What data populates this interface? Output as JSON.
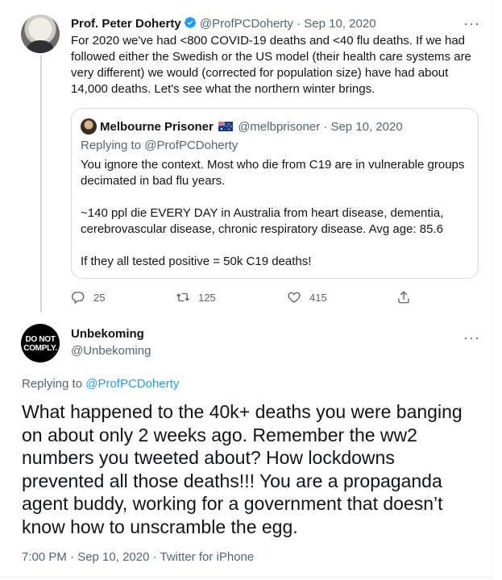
{
  "tweet1": {
    "name": "Prof. Peter Doherty",
    "handle_date": "@ProfPCDoherty · Sep 10, 2020",
    "text": "For 2020 we've had <800 COVID-19 deaths and <40 flu deaths. If we had followed either the Swedish or the US model (their health care systems are very different) we would (corrected for population size) have had about 14,000 deaths. Let's see what the northern winter brings.",
    "quote": {
      "name": "Melbourne Prisoner",
      "handle_date": "@melbprisoner · Sep 10, 2020",
      "replying_to": "Replying to @ProfPCDoherty",
      "text": "You ignore the context. Most who die from C19 are in vulnerable groups decimated in bad flu years.\n\n~140 ppl die EVERY DAY in Australia from heart disease, dementia, cerebrovascular disease, chronic respiratory disease. Avg age: 85.6\n\nIf they all tested positive = 50k C19 deaths!"
    },
    "actions": {
      "replies": "25",
      "retweets": "125",
      "likes": "415"
    }
  },
  "tweet2": {
    "avatar_text": "DO NOT COMPLY.",
    "name": "Unbekoming",
    "handle": "@Unbekoming",
    "replying_label": "Replying to",
    "replying_handle": "@ProfPCDoherty",
    "text": "What happened to the 40k+ deaths you were banging on about only 2 weeks ago. Remember the ww2 numbers you tweeted about? How lockdowns prevented all those deaths!!! You are a propaganda agent buddy, working for a government that doesn’t know how to unscramble the egg.",
    "meta": "7:00 PM · Sep 10, 2020 · Twitter for iPhone"
  },
  "colors": {
    "text": "#0f1419",
    "muted": "#536471",
    "link": "#1d9bf0",
    "verified": "#1d9bf0",
    "border": "#cfd9de"
  },
  "icons": [
    "verified-badge-icon",
    "more-icon",
    "reply-icon",
    "retweet-icon",
    "like-icon",
    "share-icon",
    "australia-flag-icon"
  ]
}
